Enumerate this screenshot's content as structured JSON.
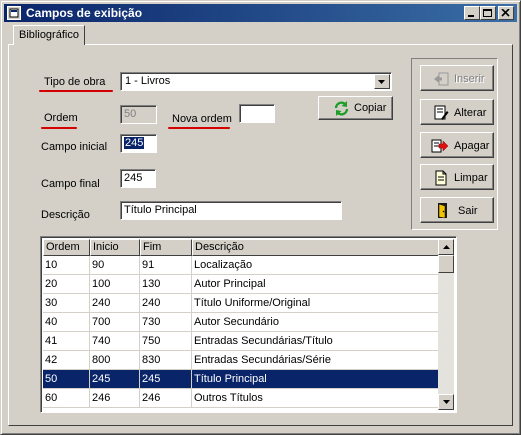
{
  "window": {
    "title": "Campos de exibição"
  },
  "tabs": [
    {
      "label": "Bibliográfico"
    }
  ],
  "form": {
    "tipo_obra_label": "Tipo de obra",
    "tipo_obra_value": "1 - Livros",
    "ordem_label": "Ordem",
    "ordem_value": "50",
    "nova_ordem_label": "Nova ordem",
    "nova_ordem_value": "",
    "copiar_label": "Copiar",
    "campo_inicial_label": "Campo inicial",
    "campo_inicial_value": "245",
    "campo_final_label": "Campo final",
    "campo_final_value": "245",
    "descricao_label": "Descrição",
    "descricao_value": "Título Principal"
  },
  "actions": {
    "inserir": "Inserir",
    "alterar": "Alterar",
    "apagar": "Apagar",
    "limpar": "Limpar",
    "sair": "Sair"
  },
  "grid": {
    "columns": [
      "Ordem",
      "Inicio",
      "Fim",
      "Descrição"
    ],
    "rows": [
      [
        "10",
        "90",
        "91",
        "Localização"
      ],
      [
        "20",
        "100",
        "130",
        "Autor Principal"
      ],
      [
        "30",
        "240",
        "240",
        "Título Uniforme/Original"
      ],
      [
        "40",
        "700",
        "730",
        "Autor Secundário"
      ],
      [
        "41",
        "740",
        "750",
        "Entradas Secundárias/Título"
      ],
      [
        "42",
        "800",
        "830",
        "Entradas Secundárias/Série"
      ],
      [
        "50",
        "245",
        "245",
        "Título Principal"
      ],
      [
        "60",
        "246",
        "246",
        "Outros Títulos"
      ]
    ],
    "selected_index": 6
  },
  "colors": {
    "titlebar": "#0a246a",
    "selection": "#0a246a",
    "annotation_underline": "#d40000",
    "face": "#d4d0c8"
  },
  "icons": [
    "app-icon",
    "minimize-icon",
    "maximize-icon",
    "close-icon",
    "dropdown-arrow-icon",
    "refresh-icon",
    "insert-icon",
    "edit-icon",
    "delete-icon",
    "clear-icon",
    "exit-door-icon",
    "scroll-up-icon",
    "scroll-down-icon"
  ]
}
